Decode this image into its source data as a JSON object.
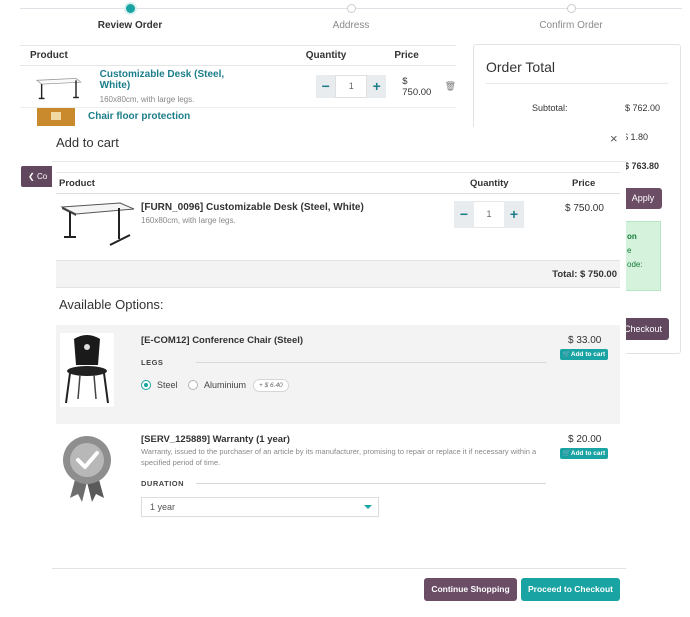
{
  "progress": {
    "steps": [
      {
        "label": "Review Order",
        "active": true
      },
      {
        "label": "Address",
        "active": false
      },
      {
        "label": "Confirm Order",
        "active": false
      }
    ]
  },
  "cart": {
    "columns": {
      "product": "Product",
      "quantity": "Quantity",
      "price": "Price"
    },
    "rows": [
      {
        "name": "Customizable Desk (Steel, White)",
        "desc": "160x80cm, with large legs.",
        "quantity": "1",
        "price": "$ 750.00"
      },
      {
        "name": "Chair floor protection"
      }
    ],
    "back_label": "Co"
  },
  "order_total": {
    "title": "Order Total",
    "subtotal_label": "Subtotal:",
    "subtotal_value": "$ 762.00",
    "line2_value": "$ 1.80",
    "total_value": "$ 763.80",
    "apply_label": "Apply",
    "coupon_lines": [
      "on",
      "e",
      "ode:"
    ],
    "checkout_label": "Checkout"
  },
  "modal": {
    "title": "Add to cart",
    "close": "×",
    "columns": {
      "product": "Product",
      "quantity": "Quantity",
      "price": "Price"
    },
    "main_product": {
      "title": "[FURN_0096] Customizable Desk (Steel, White)",
      "desc": "160x80cm, with large legs.",
      "quantity": "1",
      "price": "$ 750.00"
    },
    "total": "Total: $ 750.00",
    "available_title": "Available Options:",
    "options": [
      {
        "title": "[E-COM12] Conference Chair (Steel)",
        "price": "$ 33.00",
        "add_label": "Add to cart",
        "attribute": "LEGS",
        "values": [
          {
            "label": "Steel",
            "selected": true
          },
          {
            "label": "Aluminium",
            "selected": false,
            "extra": "+ $ 6.40"
          }
        ]
      },
      {
        "title": "[SERV_125889] Warranty (1 year)",
        "price": "$ 20.00",
        "add_label": "Add to cart",
        "desc": "Warranty, issued to the purchaser of an article by its manufacturer, promising to repair or replace it if necessary within a specified period of time.",
        "attribute": "DURATION",
        "selected": "1 year"
      }
    ],
    "continue_label": "Continue Shopping",
    "checkout_label": "Proceed to Checkout"
  },
  "colors": {
    "accent": "#1aa3a3",
    "secondary": "#6b4d66"
  }
}
